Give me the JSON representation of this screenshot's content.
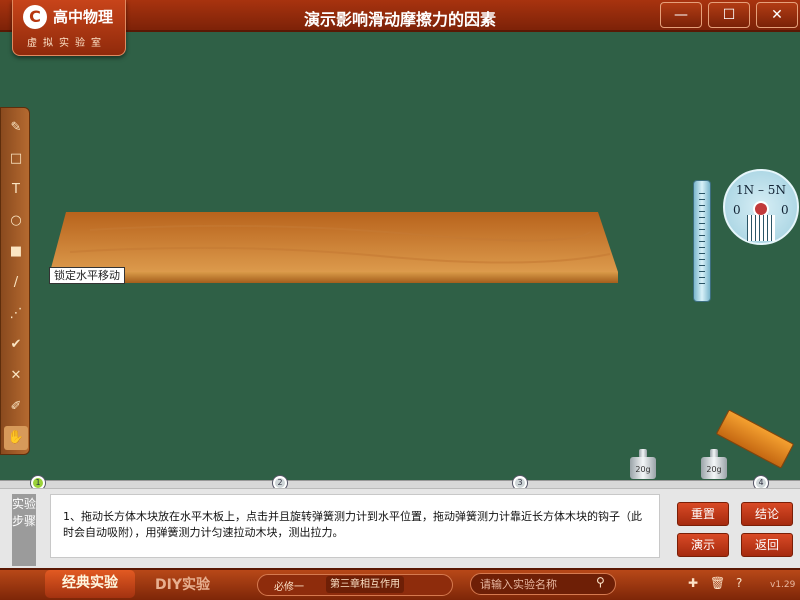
{
  "app": {
    "logo_mark": "C",
    "logo_title": "高中物理",
    "logo_subtitle": "虚拟实验室",
    "title": "演示影响滑动摩擦力的因素"
  },
  "window_controls": {
    "minimize": "—",
    "maximize": "☐",
    "close": "✕"
  },
  "toolbar": {
    "tools": [
      {
        "name": "pencil-icon",
        "glyph": "✎"
      },
      {
        "name": "rectangle-icon",
        "glyph": "□"
      },
      {
        "name": "text-icon",
        "glyph": "T"
      },
      {
        "name": "circle-icon",
        "glyph": "○"
      },
      {
        "name": "color-swatch-icon",
        "glyph": "■"
      },
      {
        "name": "line-icon",
        "glyph": "/"
      },
      {
        "name": "dashed-line-icon",
        "glyph": "⋰"
      },
      {
        "name": "check-icon",
        "glyph": "✔"
      },
      {
        "name": "eraser-x-icon",
        "glyph": "✕"
      },
      {
        "name": "brush-icon",
        "glyph": "✐"
      },
      {
        "name": "hand-icon",
        "glyph": "✋"
      }
    ]
  },
  "stage": {
    "lock_label": "锁定水平移动",
    "meter": {
      "range_label": "1N – 5N",
      "zero_left": "0",
      "zero_right": "0"
    },
    "weights": [
      "20g",
      "20g"
    ]
  },
  "steps": {
    "markers": [
      "1",
      "2",
      "3",
      "4"
    ],
    "active": 1
  },
  "panel": {
    "tab_label": "实验步骤",
    "instruction": "1、拖动长方体木块放在水平木板上，点击并且旋转弹簧测力计到水平位置，拖动弹簧测力计靠近长方体木块的钩子（此时会自动吸附），用弹簧测力计匀速拉动木块，测出拉力。",
    "buttons": {
      "reset": "重置",
      "conclude": "结论",
      "demo": "演示",
      "back": "返回"
    }
  },
  "bottom": {
    "tab_classic": "经典实验",
    "tab_diy": "DIY实验",
    "filter_book": "必修一",
    "filter_chapter": "第三章相互作用",
    "search_placeholder": "请输入实验名称",
    "version": "v1.29"
  },
  "colors": {
    "board": "#2f6046",
    "frame": "#a8330f",
    "accent": "#d94a26",
    "wood": "#c97a2e"
  }
}
